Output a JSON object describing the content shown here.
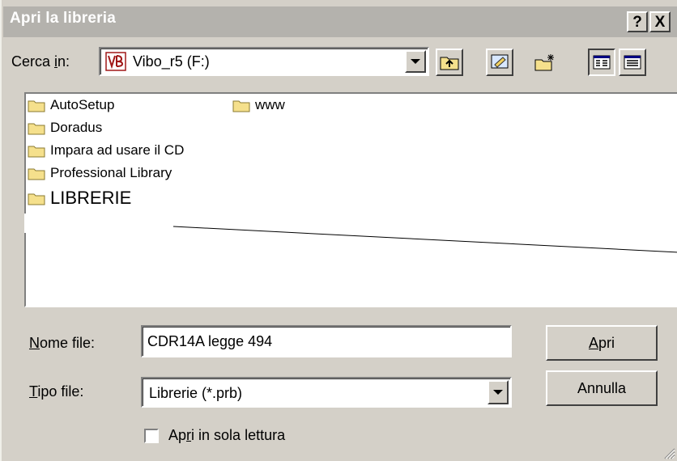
{
  "window": {
    "title": "Apri la libreria",
    "help_button": "?",
    "close_button": "X"
  },
  "lookin": {
    "label_pre": "Cerca ",
    "label_accel": "i",
    "label_post": "n:",
    "drive_label": "Vibo_r5 (F:)",
    "drive_icon": "vibo-logo-icon"
  },
  "toolbar": {
    "buttons": [
      "up-folder-icon",
      "desktop-icon",
      "new-folder-icon",
      "list-view-icon",
      "details-view-icon"
    ]
  },
  "files": {
    "items": [
      {
        "name": "AutoSetup",
        "icon": "folder-icon"
      },
      {
        "name": "Doradus",
        "icon": "folder-icon"
      },
      {
        "name": "Impara ad usare il CD",
        "icon": "folder-icon"
      },
      {
        "name": "Professional Library",
        "icon": "folder-icon"
      },
      {
        "name": "LIBRERIE",
        "icon": "folder-icon"
      },
      {
        "name": "www",
        "icon": "folder-icon"
      }
    ]
  },
  "filename": {
    "label_accel": "N",
    "label_post": "ome file:",
    "value": "CDR14A legge 494"
  },
  "filetype": {
    "label_accel": "T",
    "label_post": "ipo file:",
    "value": "Librerie (*.prb)"
  },
  "buttons": {
    "open_accel": "A",
    "open_post": "pri",
    "cancel": "Annulla"
  },
  "readonly": {
    "label_pre": "Ap",
    "label_accel": "r",
    "label_post": "i in sola lettura",
    "checked": false
  },
  "colors": {
    "face": "#d4d0c8",
    "titlebar_inactive": "#b4b2ad",
    "folder": "#f5e08c"
  }
}
